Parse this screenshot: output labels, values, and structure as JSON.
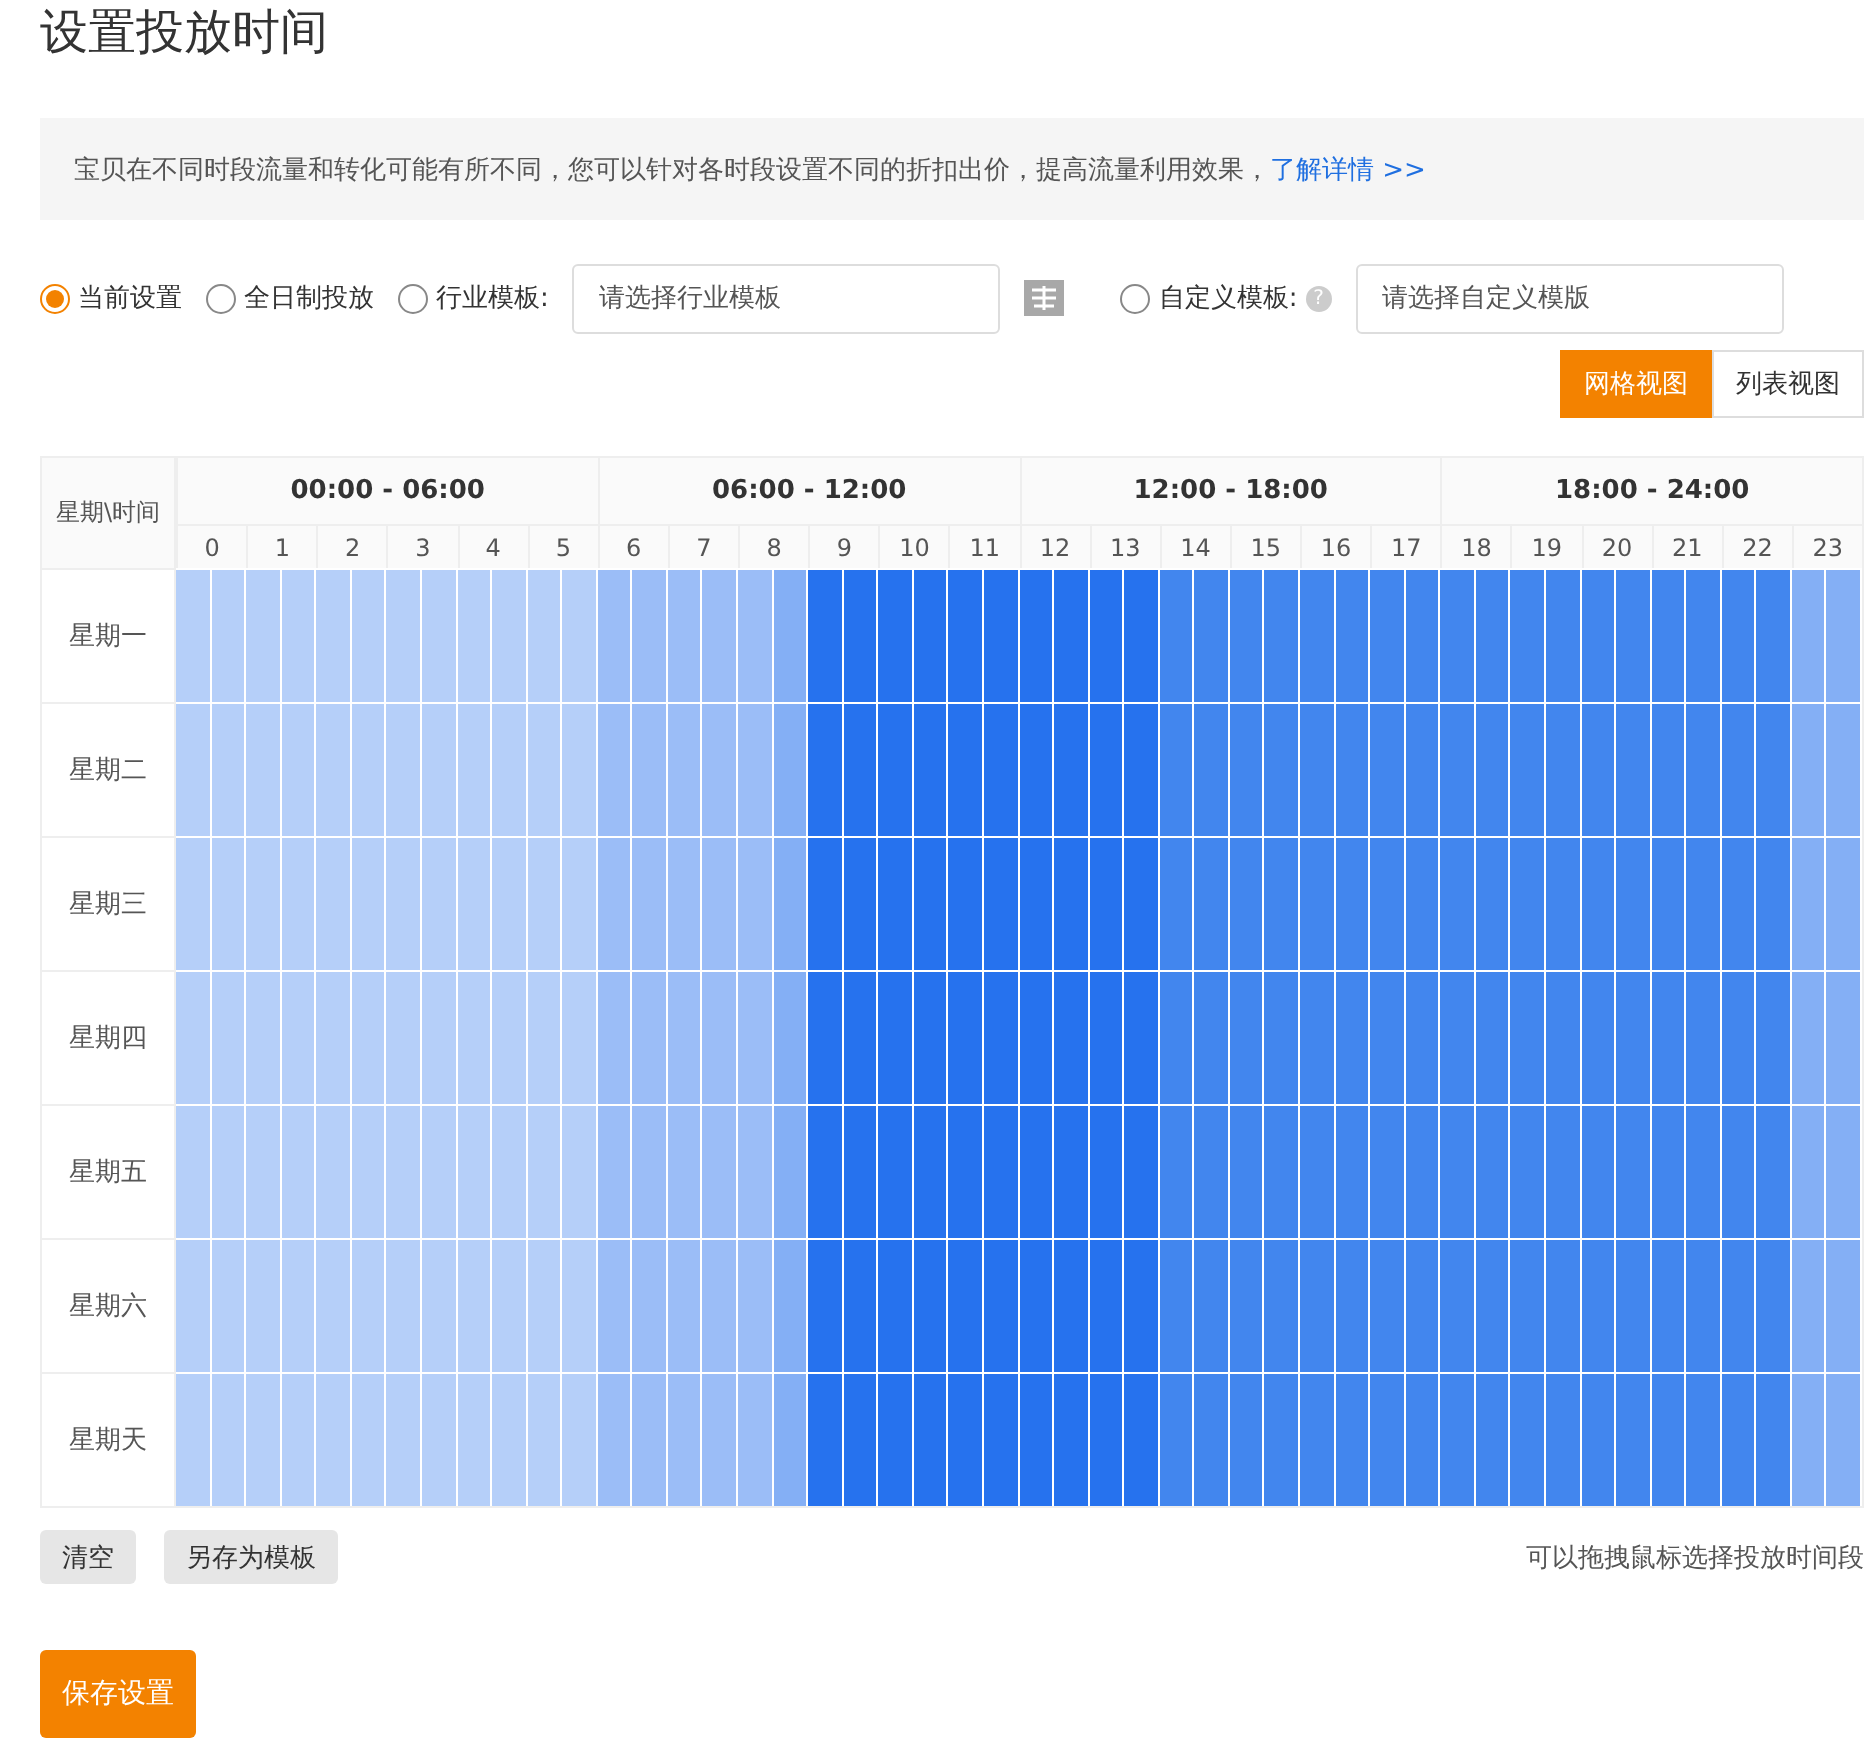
{
  "title": "设置投放时间",
  "notice": {
    "text": "宝贝在不同时段流量和转化可能有所不同，您可以针对各时段设置不同的折扣出价，提高流量利用效果，",
    "link": "了解详情 >>"
  },
  "modes": [
    {
      "kind": "plain",
      "label": "当前设置",
      "selected": true
    },
    {
      "kind": "plain",
      "label": "全日制投放",
      "selected": false
    },
    {
      "kind": "template",
      "label": "行业模板:",
      "selected": false,
      "placeholder": "请选择行业模板"
    },
    {
      "kind": "help-template",
      "label": "自定义模板:",
      "help": "?",
      "selected": false,
      "placeholder": "请选择自定义模版"
    }
  ],
  "views": [
    {
      "label": "网格视图",
      "selected": true
    },
    {
      "label": "列表视图",
      "selected": false
    }
  ],
  "grid": {
    "corner": "星期\\时间",
    "periods": [
      "00:00 - 06:00",
      "06:00 - 12:00",
      "12:00 - 18:00",
      "18:00 - 24:00"
    ],
    "hours": [
      "0",
      "1",
      "2",
      "3",
      "4",
      "5",
      "6",
      "7",
      "8",
      "9",
      "10",
      "11",
      "12",
      "13",
      "14",
      "15",
      "16",
      "17",
      "18",
      "19",
      "20",
      "21",
      "22",
      "23"
    ],
    "rows": [
      {
        "day": "星期一",
        "cells": [
          {
            "color": "#b5cff9"
          },
          {
            "color": "#b5cff9"
          },
          {
            "color": "#b5cff9"
          },
          {
            "color": "#b5cff9"
          },
          {
            "color": "#b5cff9"
          },
          {
            "color": "#b5cff9"
          },
          {
            "color": "#b5cff9"
          },
          {
            "color": "#b5cff9"
          },
          {
            "color": "#b5cff9"
          },
          {
            "color": "#b5cff9"
          },
          {
            "color": "#b5cff9"
          },
          {
            "color": "#b5cff9"
          },
          {
            "color": "#9bbdf7"
          },
          {
            "color": "#9bbdf7"
          },
          {
            "color": "#9bbdf7"
          },
          {
            "color": "#9bbdf7"
          },
          {
            "color": "#9bbdf7"
          },
          {
            "color": "#84aff5"
          },
          {
            "color": "#2672ee"
          },
          {
            "color": "#2672ee"
          },
          {
            "color": "#2672ee"
          },
          {
            "color": "#2672ee"
          },
          {
            "color": "#2672ee"
          },
          {
            "color": "#2672ee"
          },
          {
            "color": "#2672ee"
          },
          {
            "color": "#2672ee"
          },
          {
            "color": "#2672ee"
          },
          {
            "color": "#2672ee"
          },
          {
            "color": "#4286ee"
          },
          {
            "color": "#4286ee"
          },
          {
            "color": "#4286ee"
          },
          {
            "color": "#4286ee"
          },
          {
            "color": "#4286ee"
          },
          {
            "color": "#4286ee"
          },
          {
            "color": "#4286ee"
          },
          {
            "color": "#4286ee"
          },
          {
            "color": "#4286ee"
          },
          {
            "color": "#4286ee"
          },
          {
            "color": "#4286ee"
          },
          {
            "color": "#4286ee"
          },
          {
            "color": "#4286ee"
          },
          {
            "color": "#4286ee"
          },
          {
            "color": "#4286ee"
          },
          {
            "color": "#4286ee"
          },
          {
            "color": "#4286ee"
          },
          {
            "color": "#4286ee"
          },
          {
            "color": "#84aff5"
          },
          {
            "color": "#84aff5"
          }
        ]
      },
      {
        "day": "星期二",
        "cells": [
          {
            "color": "#b5cff9"
          },
          {
            "color": "#b5cff9"
          },
          {
            "color": "#b5cff9"
          },
          {
            "color": "#b5cff9"
          },
          {
            "color": "#b5cff9"
          },
          {
            "color": "#b5cff9"
          },
          {
            "color": "#b5cff9"
          },
          {
            "color": "#b5cff9"
          },
          {
            "color": "#b5cff9"
          },
          {
            "color": "#b5cff9"
          },
          {
            "color": "#b5cff9"
          },
          {
            "color": "#b5cff9"
          },
          {
            "color": "#9bbdf7"
          },
          {
            "color": "#9bbdf7"
          },
          {
            "color": "#9bbdf7"
          },
          {
            "color": "#9bbdf7"
          },
          {
            "color": "#9bbdf7"
          },
          {
            "color": "#84aff5"
          },
          {
            "color": "#2672ee"
          },
          {
            "color": "#2672ee"
          },
          {
            "color": "#2672ee"
          },
          {
            "color": "#2672ee"
          },
          {
            "color": "#2672ee"
          },
          {
            "color": "#2672ee"
          },
          {
            "color": "#2672ee"
          },
          {
            "color": "#2672ee"
          },
          {
            "color": "#2672ee"
          },
          {
            "color": "#2672ee"
          },
          {
            "color": "#4286ee"
          },
          {
            "color": "#4286ee"
          },
          {
            "color": "#4286ee"
          },
          {
            "color": "#4286ee"
          },
          {
            "color": "#4286ee"
          },
          {
            "color": "#4286ee"
          },
          {
            "color": "#4286ee"
          },
          {
            "color": "#4286ee"
          },
          {
            "color": "#4286ee"
          },
          {
            "color": "#4286ee"
          },
          {
            "color": "#4286ee"
          },
          {
            "color": "#4286ee"
          },
          {
            "color": "#4286ee"
          },
          {
            "color": "#4286ee"
          },
          {
            "color": "#4286ee"
          },
          {
            "color": "#4286ee"
          },
          {
            "color": "#4286ee"
          },
          {
            "color": "#4286ee"
          },
          {
            "color": "#84aff5"
          },
          {
            "color": "#84aff5"
          }
        ]
      },
      {
        "day": "星期三",
        "cells": [
          {
            "color": "#b5cff9"
          },
          {
            "color": "#b5cff9"
          },
          {
            "color": "#b5cff9"
          },
          {
            "color": "#b5cff9"
          },
          {
            "color": "#b5cff9"
          },
          {
            "color": "#b5cff9"
          },
          {
            "color": "#b5cff9"
          },
          {
            "color": "#b5cff9"
          },
          {
            "color": "#b5cff9"
          },
          {
            "color": "#b5cff9"
          },
          {
            "color": "#b5cff9"
          },
          {
            "color": "#b5cff9"
          },
          {
            "color": "#9bbdf7"
          },
          {
            "color": "#9bbdf7"
          },
          {
            "color": "#9bbdf7"
          },
          {
            "color": "#9bbdf7"
          },
          {
            "color": "#9bbdf7"
          },
          {
            "color": "#84aff5"
          },
          {
            "color": "#2672ee"
          },
          {
            "color": "#2672ee"
          },
          {
            "color": "#2672ee"
          },
          {
            "color": "#2672ee"
          },
          {
            "color": "#2672ee"
          },
          {
            "color": "#2672ee"
          },
          {
            "color": "#2672ee"
          },
          {
            "color": "#2672ee"
          },
          {
            "color": "#2672ee"
          },
          {
            "color": "#2672ee"
          },
          {
            "color": "#4286ee"
          },
          {
            "color": "#4286ee"
          },
          {
            "color": "#4286ee"
          },
          {
            "color": "#4286ee"
          },
          {
            "color": "#4286ee"
          },
          {
            "color": "#4286ee"
          },
          {
            "color": "#4286ee"
          },
          {
            "color": "#4286ee"
          },
          {
            "color": "#4286ee"
          },
          {
            "color": "#4286ee"
          },
          {
            "color": "#4286ee"
          },
          {
            "color": "#4286ee"
          },
          {
            "color": "#4286ee"
          },
          {
            "color": "#4286ee"
          },
          {
            "color": "#4286ee"
          },
          {
            "color": "#4286ee"
          },
          {
            "color": "#4286ee"
          },
          {
            "color": "#4286ee"
          },
          {
            "color": "#84aff5"
          },
          {
            "color": "#84aff5"
          }
        ]
      },
      {
        "day": "星期四",
        "cells": [
          {
            "color": "#b5cff9"
          },
          {
            "color": "#b5cff9"
          },
          {
            "color": "#b5cff9"
          },
          {
            "color": "#b5cff9"
          },
          {
            "color": "#b5cff9"
          },
          {
            "color": "#b5cff9"
          },
          {
            "color": "#b5cff9"
          },
          {
            "color": "#b5cff9"
          },
          {
            "color": "#b5cff9"
          },
          {
            "color": "#b5cff9"
          },
          {
            "color": "#b5cff9"
          },
          {
            "color": "#b5cff9"
          },
          {
            "color": "#9bbdf7"
          },
          {
            "color": "#9bbdf7"
          },
          {
            "color": "#9bbdf7"
          },
          {
            "color": "#9bbdf7"
          },
          {
            "color": "#9bbdf7"
          },
          {
            "color": "#84aff5"
          },
          {
            "color": "#2672ee"
          },
          {
            "color": "#2672ee"
          },
          {
            "color": "#2672ee"
          },
          {
            "color": "#2672ee"
          },
          {
            "color": "#2672ee"
          },
          {
            "color": "#2672ee"
          },
          {
            "color": "#2672ee"
          },
          {
            "color": "#2672ee"
          },
          {
            "color": "#2672ee"
          },
          {
            "color": "#2672ee"
          },
          {
            "color": "#4286ee"
          },
          {
            "color": "#4286ee"
          },
          {
            "color": "#4286ee"
          },
          {
            "color": "#4286ee"
          },
          {
            "color": "#4286ee"
          },
          {
            "color": "#4286ee"
          },
          {
            "color": "#4286ee"
          },
          {
            "color": "#4286ee"
          },
          {
            "color": "#4286ee"
          },
          {
            "color": "#4286ee"
          },
          {
            "color": "#4286ee"
          },
          {
            "color": "#4286ee"
          },
          {
            "color": "#4286ee"
          },
          {
            "color": "#4286ee"
          },
          {
            "color": "#4286ee"
          },
          {
            "color": "#4286ee"
          },
          {
            "color": "#4286ee"
          },
          {
            "color": "#4286ee"
          },
          {
            "color": "#84aff5"
          },
          {
            "color": "#84aff5"
          }
        ]
      },
      {
        "day": "星期五",
        "cells": [
          {
            "color": "#b5cff9"
          },
          {
            "color": "#b5cff9"
          },
          {
            "color": "#b5cff9"
          },
          {
            "color": "#b5cff9"
          },
          {
            "color": "#b5cff9"
          },
          {
            "color": "#b5cff9"
          },
          {
            "color": "#b5cff9"
          },
          {
            "color": "#b5cff9"
          },
          {
            "color": "#b5cff9"
          },
          {
            "color": "#b5cff9"
          },
          {
            "color": "#b5cff9"
          },
          {
            "color": "#b5cff9"
          },
          {
            "color": "#9bbdf7"
          },
          {
            "color": "#9bbdf7"
          },
          {
            "color": "#9bbdf7"
          },
          {
            "color": "#9bbdf7"
          },
          {
            "color": "#9bbdf7"
          },
          {
            "color": "#84aff5"
          },
          {
            "color": "#2672ee"
          },
          {
            "color": "#2672ee"
          },
          {
            "color": "#2672ee"
          },
          {
            "color": "#2672ee"
          },
          {
            "color": "#2672ee"
          },
          {
            "color": "#2672ee"
          },
          {
            "color": "#2672ee"
          },
          {
            "color": "#2672ee"
          },
          {
            "color": "#2672ee"
          },
          {
            "color": "#2672ee"
          },
          {
            "color": "#4286ee"
          },
          {
            "color": "#4286ee"
          },
          {
            "color": "#4286ee"
          },
          {
            "color": "#4286ee"
          },
          {
            "color": "#4286ee"
          },
          {
            "color": "#4286ee"
          },
          {
            "color": "#4286ee"
          },
          {
            "color": "#4286ee"
          },
          {
            "color": "#4286ee"
          },
          {
            "color": "#4286ee"
          },
          {
            "color": "#4286ee"
          },
          {
            "color": "#4286ee"
          },
          {
            "color": "#4286ee"
          },
          {
            "color": "#4286ee"
          },
          {
            "color": "#4286ee"
          },
          {
            "color": "#4286ee"
          },
          {
            "color": "#4286ee"
          },
          {
            "color": "#4286ee"
          },
          {
            "color": "#84aff5"
          },
          {
            "color": "#84aff5"
          }
        ]
      },
      {
        "day": "星期六",
        "cells": [
          {
            "color": "#b5cff9"
          },
          {
            "color": "#b5cff9"
          },
          {
            "color": "#b5cff9"
          },
          {
            "color": "#b5cff9"
          },
          {
            "color": "#b5cff9"
          },
          {
            "color": "#b5cff9"
          },
          {
            "color": "#b5cff9"
          },
          {
            "color": "#b5cff9"
          },
          {
            "color": "#b5cff9"
          },
          {
            "color": "#b5cff9"
          },
          {
            "color": "#b5cff9"
          },
          {
            "color": "#b5cff9"
          },
          {
            "color": "#9bbdf7"
          },
          {
            "color": "#9bbdf7"
          },
          {
            "color": "#9bbdf7"
          },
          {
            "color": "#9bbdf7"
          },
          {
            "color": "#9bbdf7"
          },
          {
            "color": "#84aff5"
          },
          {
            "color": "#2672ee"
          },
          {
            "color": "#2672ee"
          },
          {
            "color": "#2672ee"
          },
          {
            "color": "#2672ee"
          },
          {
            "color": "#2672ee"
          },
          {
            "color": "#2672ee"
          },
          {
            "color": "#2672ee"
          },
          {
            "color": "#2672ee"
          },
          {
            "color": "#2672ee"
          },
          {
            "color": "#2672ee"
          },
          {
            "color": "#4286ee"
          },
          {
            "color": "#4286ee"
          },
          {
            "color": "#4286ee"
          },
          {
            "color": "#4286ee"
          },
          {
            "color": "#4286ee"
          },
          {
            "color": "#4286ee"
          },
          {
            "color": "#4286ee"
          },
          {
            "color": "#4286ee"
          },
          {
            "color": "#4286ee"
          },
          {
            "color": "#4286ee"
          },
          {
            "color": "#4286ee"
          },
          {
            "color": "#4286ee"
          },
          {
            "color": "#4286ee"
          },
          {
            "color": "#4286ee"
          },
          {
            "color": "#4286ee"
          },
          {
            "color": "#4286ee"
          },
          {
            "color": "#4286ee"
          },
          {
            "color": "#4286ee"
          },
          {
            "color": "#84aff5"
          },
          {
            "color": "#84aff5"
          }
        ]
      },
      {
        "day": "星期天",
        "cells": [
          {
            "color": "#b5cff9"
          },
          {
            "color": "#b5cff9"
          },
          {
            "color": "#b5cff9"
          },
          {
            "color": "#b5cff9"
          },
          {
            "color": "#b5cff9"
          },
          {
            "color": "#b5cff9"
          },
          {
            "color": "#b5cff9"
          },
          {
            "color": "#b5cff9"
          },
          {
            "color": "#b5cff9"
          },
          {
            "color": "#b5cff9"
          },
          {
            "color": "#b5cff9"
          },
          {
            "color": "#b5cff9"
          },
          {
            "color": "#9bbdf7"
          },
          {
            "color": "#9bbdf7"
          },
          {
            "color": "#9bbdf7"
          },
          {
            "color": "#9bbdf7"
          },
          {
            "color": "#9bbdf7"
          },
          {
            "color": "#84aff5"
          },
          {
            "color": "#2672ee"
          },
          {
            "color": "#2672ee"
          },
          {
            "color": "#2672ee"
          },
          {
            "color": "#2672ee"
          },
          {
            "color": "#2672ee"
          },
          {
            "color": "#2672ee"
          },
          {
            "color": "#2672ee"
          },
          {
            "color": "#2672ee"
          },
          {
            "color": "#2672ee"
          },
          {
            "color": "#2672ee"
          },
          {
            "color": "#4286ee"
          },
          {
            "color": "#4286ee"
          },
          {
            "color": "#4286ee"
          },
          {
            "color": "#4286ee"
          },
          {
            "color": "#4286ee"
          },
          {
            "color": "#4286ee"
          },
          {
            "color": "#4286ee"
          },
          {
            "color": "#4286ee"
          },
          {
            "color": "#4286ee"
          },
          {
            "color": "#4286ee"
          },
          {
            "color": "#4286ee"
          },
          {
            "color": "#4286ee"
          },
          {
            "color": "#4286ee"
          },
          {
            "color": "#4286ee"
          },
          {
            "color": "#4286ee"
          },
          {
            "color": "#4286ee"
          },
          {
            "color": "#4286ee"
          },
          {
            "color": "#4286ee"
          },
          {
            "color": "#84aff5"
          },
          {
            "color": "#84aff5"
          }
        ]
      }
    ]
  },
  "actions": [
    "清空",
    "另存为模板"
  ],
  "hint": "可以拖拽鼠标选择投放时间段",
  "save": "保存设置"
}
